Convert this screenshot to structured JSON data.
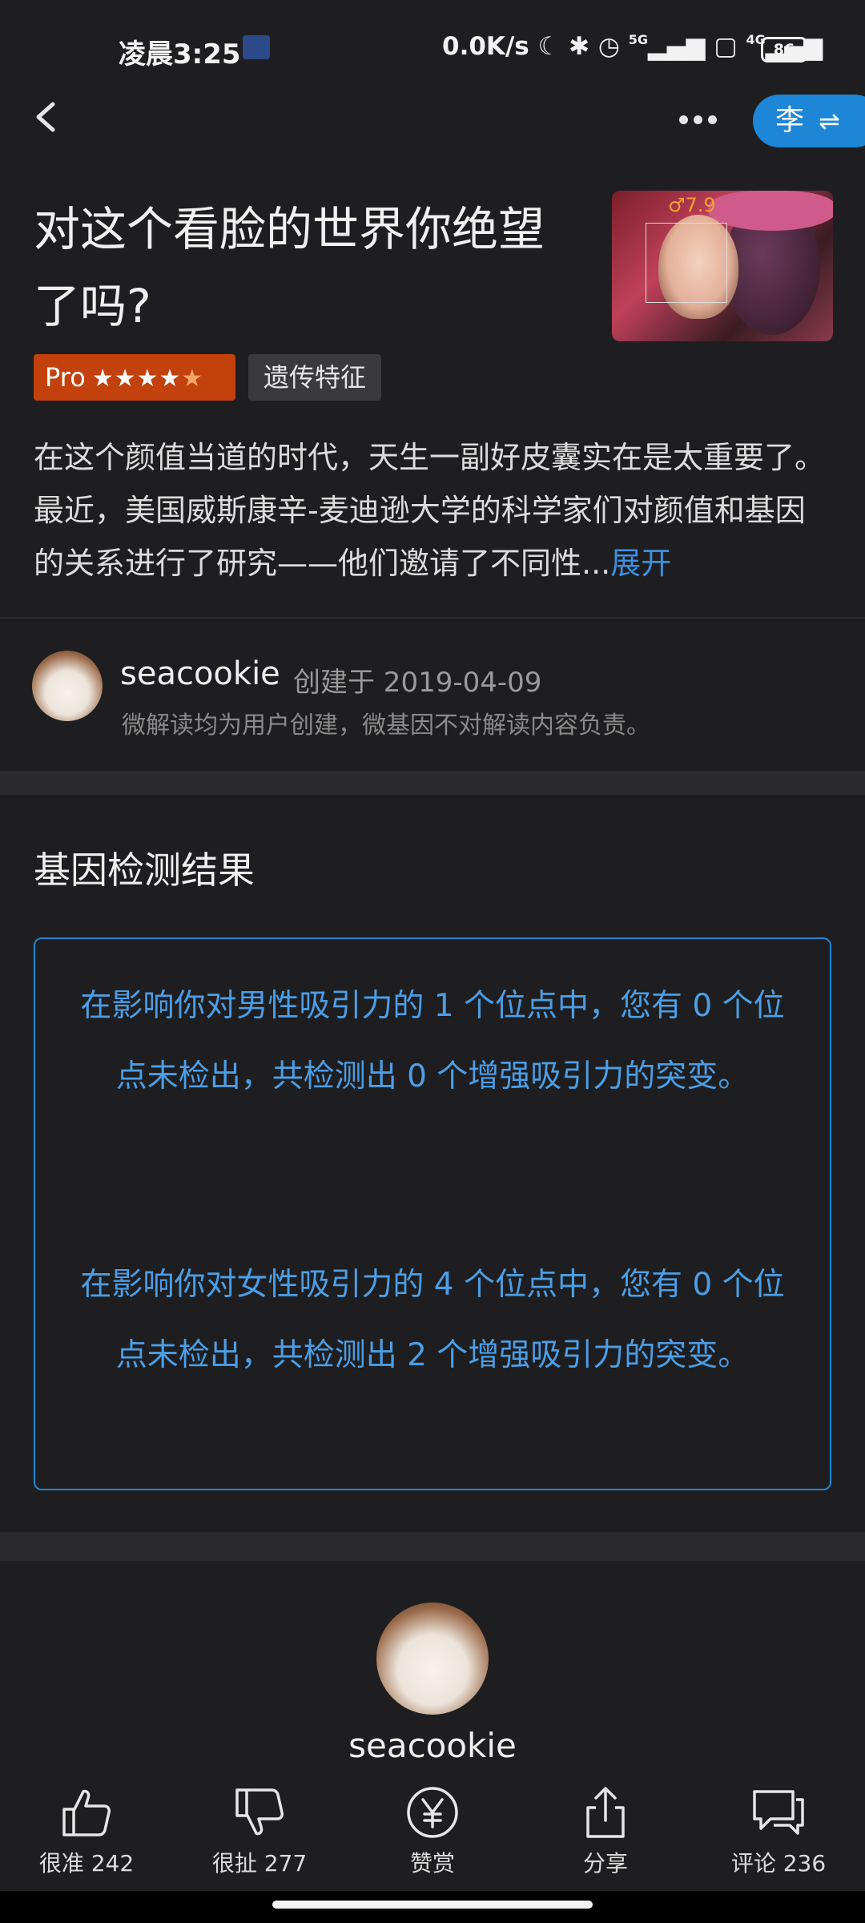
{
  "status_bar": {
    "time": "凌晨3:25",
    "network_speed": "0.0K/s",
    "signal_5g": "5G",
    "signal_4g": "4G",
    "battery": "86"
  },
  "nav": {
    "switch_label": "李",
    "switch_arrows": "⇌"
  },
  "article": {
    "title": "对这个看脸的世界你绝望了吗?",
    "thumbnail_score": "♂7.9",
    "tag_pro": "Pro",
    "tag_pro_rating": 4.5,
    "tag_category": "遗传特征",
    "description": "在这个颜值当道的时代，天生一副好皮囊实在是太重要了。最近，美国威斯康辛-麦迪逊大学的科学家们对颜值和基因的关系进行了研究——他们邀请了不同性...",
    "expand_label": "展开"
  },
  "author": {
    "name": "seacookie",
    "created": "创建于 2019-04-09",
    "disclaimer": "微解读均为用户创建，微基因不对解读内容负责。"
  },
  "results": {
    "section_title": "基因检测结果",
    "paragraph_1": "在影响你对男性吸引力的 1 个位点中，您有 0 个位点未检出，共检测出 0 个增强吸引力的突变。",
    "paragraph_2": "在影响你对女性吸引力的 4 个位点中，您有 0 个位点未检出，共检测出 2 个增强吸引力的突变。"
  },
  "profile": {
    "name": "seacookie"
  },
  "actions": [
    {
      "label": "很准 242",
      "icon": "thumbs-up-icon"
    },
    {
      "label": "很扯 277",
      "icon": "thumbs-down-icon"
    },
    {
      "label": "赞赏",
      "icon": "yen-icon"
    },
    {
      "label": "分享",
      "icon": "share-icon"
    },
    {
      "label": "评论 236",
      "icon": "comment-icon"
    }
  ],
  "colors": {
    "accent": "#1d86d6",
    "pro_tag": "#c2410c",
    "result_text": "#4b9ee6",
    "background": "#1e1e20"
  }
}
